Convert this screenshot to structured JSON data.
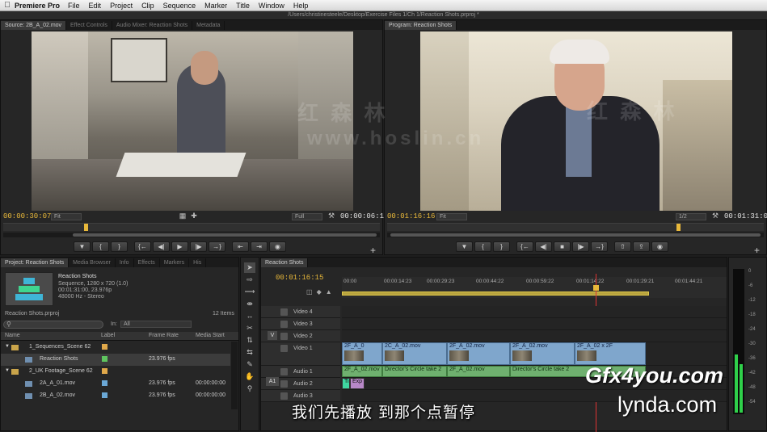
{
  "menubar": {
    "app_name": "Premiere Pro",
    "items": [
      "File",
      "Edit",
      "Project",
      "Clip",
      "Sequence",
      "Marker",
      "Title",
      "Window",
      "Help"
    ]
  },
  "path_title": "/Users/christinesteele/Desktop/Exercise Files 1/Ch 1/Reaction Shots.prproj *",
  "source_panel": {
    "tabs": [
      "Source: 2B_A_02.mov",
      "Effect Controls",
      "Audio Mixer: Reaction Shots",
      "Metadata"
    ],
    "timecode_in": "00:00:30:07",
    "timecode_duration": "00:00:06:17",
    "fit_label": "Fit",
    "quality_label": "Full"
  },
  "program_panel": {
    "tabs": [
      "Program: Reaction Shots"
    ],
    "timecode_in": "00:01:16:16",
    "timecode_duration": "00:01:31:00",
    "fit_label": "Fit",
    "quality_label": "1/2"
  },
  "transport_icons": [
    "marker",
    "in-point",
    "out-point",
    "go-to-in",
    "step-back",
    "play",
    "step-forward",
    "go-to-out",
    "insert",
    "overwrite",
    "export-frame"
  ],
  "project_panel": {
    "tabs": [
      "Project: Reaction Shots",
      "Media Browser",
      "Info",
      "Effects",
      "Markers",
      "His"
    ],
    "sequence_name": "Reaction Shots",
    "sequence_info": [
      "Sequence, 1280 x 720 (1.0)",
      "00:01:31:00, 23.976p",
      "48000 Hz - Stereo"
    ],
    "project_file": "Reaction Shots.prproj",
    "item_count": "12 Items",
    "in_label": "In:",
    "in_value": "All",
    "columns": [
      "Name",
      "Label",
      "Frame Rate",
      "Media Start"
    ],
    "rows": [
      {
        "name": "1_Sequences_Scene 62",
        "rate": "",
        "start": "",
        "color": "#e0a84a",
        "indent": 1
      },
      {
        "name": "Reaction Shots",
        "rate": "23.976 fps",
        "start": "",
        "color": "#5fc45f",
        "indent": 2
      },
      {
        "name": "2_UK Footage_Scene 62",
        "rate": "",
        "start": "",
        "color": "#e0a84a",
        "indent": 1
      },
      {
        "name": "2A_A_01.mov",
        "rate": "23.976 fps",
        "start": "00:00:00:00",
        "color": "#6ba8d6",
        "indent": 2
      },
      {
        "name": "2B_A_02.mov",
        "rate": "23.976 fps",
        "start": "00:00:00:00",
        "color": "#6ba8d6",
        "indent": 2
      }
    ]
  },
  "tools": [
    "selection",
    "track-select",
    "ripple-edit",
    "rolling-edit",
    "rate-stretch",
    "razor",
    "slip",
    "slide",
    "pen",
    "hand",
    "zoom"
  ],
  "timeline": {
    "tab": "Reaction Shots",
    "timecode": "00:01:16:15",
    "ruler_labels": [
      "00:00",
      "00:00:14:23",
      "00:00:29:23",
      "00:00:44:22",
      "00:00:59:22",
      "00:01:14:22",
      "00:01:29:21",
      "00:01:44:21"
    ],
    "tracks": [
      {
        "label": "Video 4",
        "type": "video"
      },
      {
        "label": "Video 3",
        "type": "video"
      },
      {
        "label": "Video 2",
        "type": "video"
      },
      {
        "label": "Video 1",
        "type": "video"
      },
      {
        "label": "Audio 1",
        "type": "audio"
      },
      {
        "label": "Audio 2",
        "type": "audio"
      },
      {
        "label": "Audio 3",
        "type": "audio"
      }
    ],
    "source_v": "V",
    "source_a": "A1",
    "video_clips": [
      "2F_A_0",
      "2C_A_02.mov",
      "2F_A_02.mov",
      "2F_A_02.mov",
      "2F_A_02 x 2F"
    ],
    "audio_clips": [
      "2F_A_02.mov",
      "Director's Circle take 2",
      "2F_A_02.mov",
      "Director's Circle take 2"
    ],
    "audio2_clip": "Ti",
    "audio2_clip_b": "Exp"
  },
  "audio_meter_scale": [
    "0",
    "-6",
    "-12",
    "-18",
    "-24",
    "-30",
    "-36",
    "-42",
    "-48",
    "-54"
  ],
  "watermark_cn": "红 森 林",
  "watermark_url": "www.hoslin.cn",
  "watermark_gfx": "Gfx4you.com",
  "watermark_lynda": "lynda.com",
  "subtitle": "我们先播放 到那个点暂停"
}
